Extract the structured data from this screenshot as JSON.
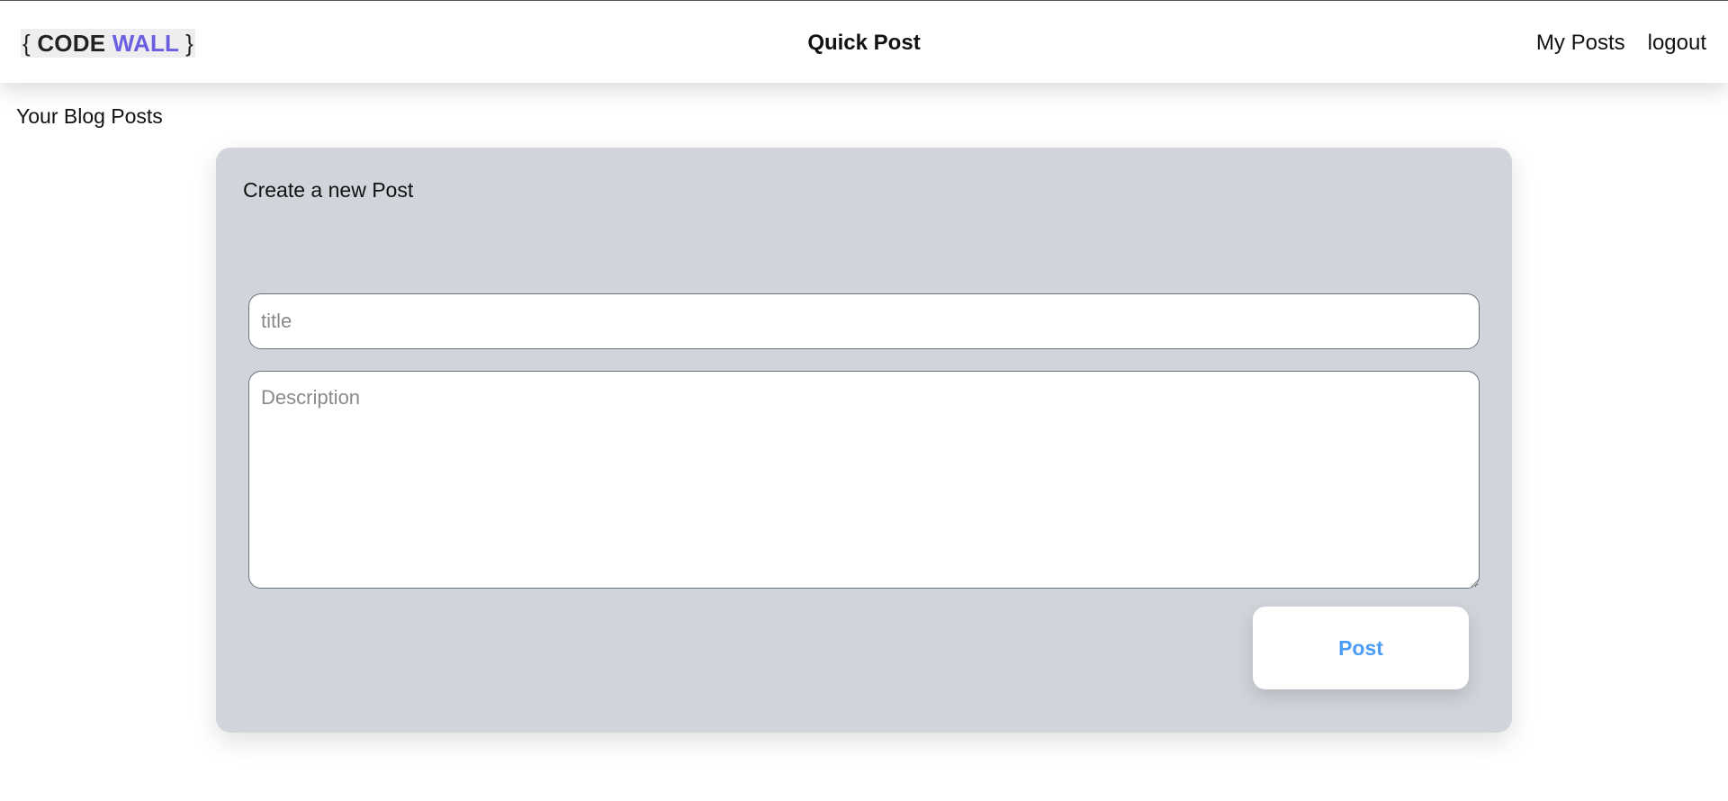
{
  "header": {
    "logo": {
      "open_brace": "{",
      "code": "CODE",
      "wall": "WALL",
      "close_brace": "}"
    },
    "title": "Quick Post",
    "nav": {
      "my_posts": "My Posts",
      "logout": "logout"
    }
  },
  "main": {
    "section_heading": "Your Blog Posts",
    "form": {
      "heading": "Create a new Post",
      "title_input": {
        "value": "",
        "placeholder": "title"
      },
      "description_input": {
        "value": "",
        "placeholder": "Description"
      },
      "submit_label": "Post"
    }
  },
  "colors": {
    "brand_accent": "#6a5fe0",
    "card_background": "#d1d5db",
    "button_text": "#4b9cf5"
  }
}
